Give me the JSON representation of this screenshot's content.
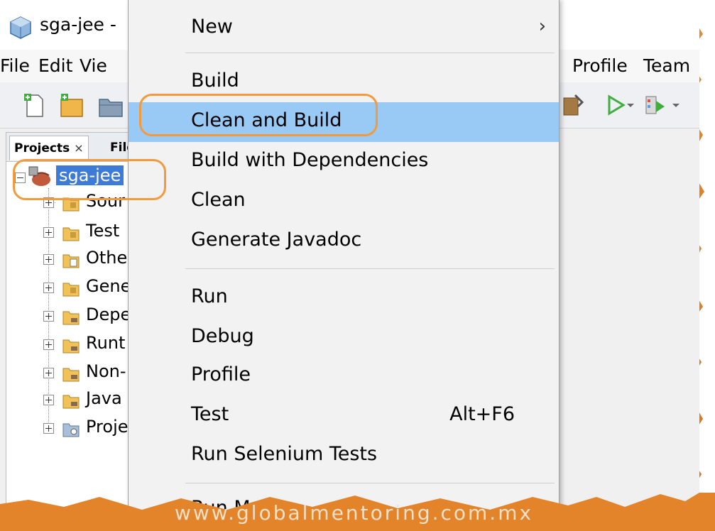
{
  "window": {
    "title": "sga-jee -"
  },
  "menubar": {
    "file": "File",
    "edit": "Edit",
    "view": "Vie",
    "profile": "Profile",
    "team": "Team"
  },
  "explorer": {
    "tabs": [
      {
        "label": "Projects",
        "close": "×"
      },
      {
        "label": "Files"
      }
    ],
    "root": "sga-jee",
    "children": [
      "Sour",
      "Test",
      "Othe",
      "Gene",
      "Depe",
      "Runt",
      "Non-",
      "Java",
      "Proje"
    ]
  },
  "context_menu": {
    "items": [
      {
        "label": "New",
        "arrow": "›"
      },
      {
        "label": "Build"
      },
      {
        "label": "Clean and Build"
      },
      {
        "label": "Build with Dependencies"
      },
      {
        "label": "Clean"
      },
      {
        "label": "Generate Javadoc"
      },
      {
        "label": "Run"
      },
      {
        "label": "Debug"
      },
      {
        "label": "Profile"
      },
      {
        "label": "Test",
        "shortcut": "Alt+F6"
      },
      {
        "label": "Run Selenium Tests"
      },
      {
        "label": "Run Maven"
      }
    ]
  },
  "watermark": "www.globalmentoring.com.mx",
  "colors": {
    "highlight": "#99c9f5",
    "selection": "#3d7bd6",
    "annotation": "#f29a3c",
    "backdrop": "#e88a2c"
  }
}
